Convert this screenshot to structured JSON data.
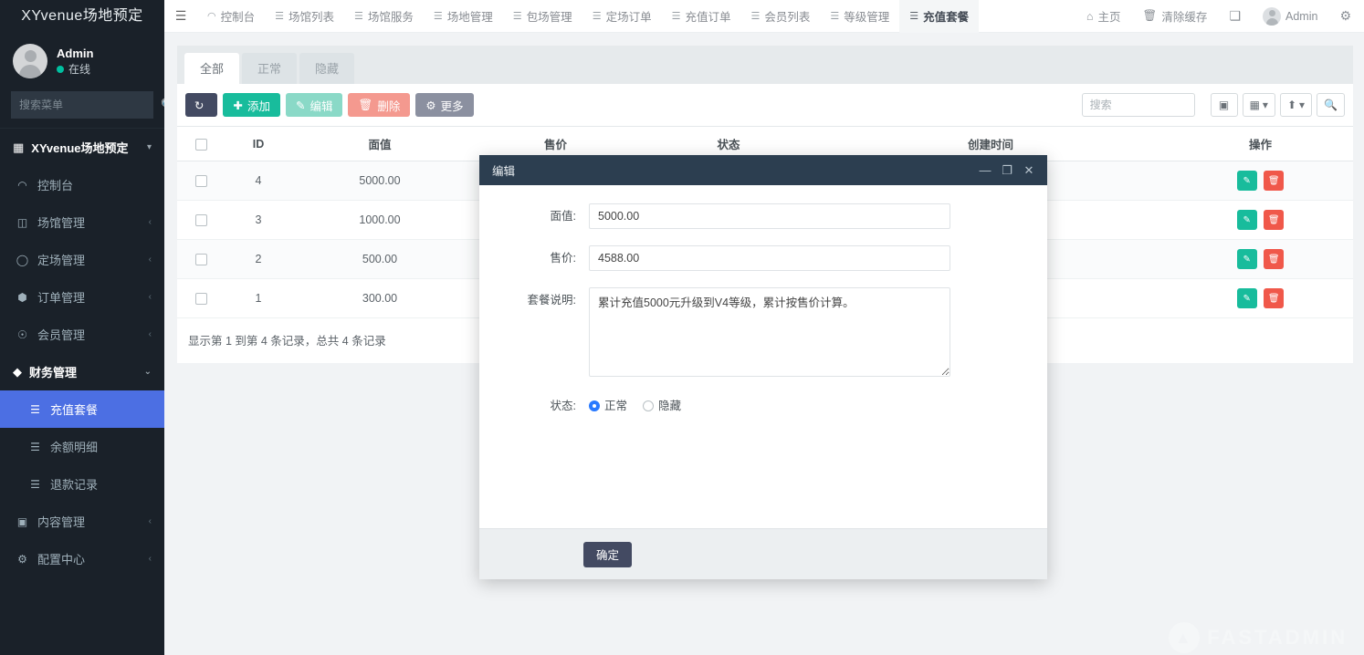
{
  "sidebar": {
    "brand": "XYvenue场地预定",
    "user": {
      "name": "Admin",
      "status": "在线"
    },
    "search_placeholder": "搜索菜单",
    "menu_head": "XYvenue场地预定",
    "items": [
      {
        "label": "控制台",
        "icon": "dashboard-icon",
        "caret": "",
        "active": false
      },
      {
        "label": "场馆管理",
        "icon": "columns-icon",
        "caret": "‹",
        "active": false
      },
      {
        "label": "定场管理",
        "icon": "clock-icon",
        "caret": "‹",
        "active": false
      },
      {
        "label": "订单管理",
        "icon": "cube-icon",
        "caret": "‹",
        "active": false
      },
      {
        "label": "会员管理",
        "icon": "user-icon",
        "caret": "‹",
        "active": false
      },
      {
        "label": "财务管理",
        "icon": "diamond-icon",
        "caret": "⌄",
        "active": false
      },
      {
        "label": "充值套餐",
        "icon": "list-icon",
        "caret": "",
        "active": true,
        "sub": true
      },
      {
        "label": "余额明细",
        "icon": "list-icon",
        "caret": "",
        "active": false,
        "sub": true
      },
      {
        "label": "退款记录",
        "icon": "list-icon",
        "caret": "",
        "active": false,
        "sub": true
      },
      {
        "label": "内容管理",
        "icon": "edit-square-icon",
        "caret": "‹",
        "active": false
      },
      {
        "label": "配置中心",
        "icon": "gear-icon",
        "caret": "‹",
        "active": false
      }
    ]
  },
  "topnav": {
    "toggle_icon": "hamburger-icon",
    "tabs": [
      {
        "label": "控制台",
        "icon": "dashboard-icon",
        "active": false
      },
      {
        "label": "场馆列表",
        "icon": "list-icon",
        "active": false
      },
      {
        "label": "场馆服务",
        "icon": "list-icon",
        "active": false
      },
      {
        "label": "场地管理",
        "icon": "list-icon",
        "active": false
      },
      {
        "label": "包场管理",
        "icon": "list-icon",
        "active": false
      },
      {
        "label": "定场订单",
        "icon": "list-icon",
        "active": false
      },
      {
        "label": "充值订单",
        "icon": "list-icon",
        "active": false
      },
      {
        "label": "会员列表",
        "icon": "list-icon",
        "active": false
      },
      {
        "label": "等级管理",
        "icon": "list-icon",
        "active": false
      },
      {
        "label": "充值套餐",
        "icon": "list-icon",
        "active": true
      }
    ],
    "right": [
      {
        "label": "主页",
        "icon": "home-icon"
      },
      {
        "label": "清除缓存",
        "icon": "trash-icon"
      },
      {
        "label": "",
        "icon": "fullscreen-icon"
      },
      {
        "label": "Admin",
        "icon": "avatar-icon"
      },
      {
        "label": "",
        "icon": "gears-icon"
      }
    ]
  },
  "panel": {
    "tabs": [
      {
        "label": "全部",
        "active": true
      },
      {
        "label": "正常",
        "active": false
      },
      {
        "label": "隐藏",
        "active": false
      }
    ],
    "toolbar": {
      "refresh_label": "",
      "add_label": "添加",
      "edit_label": "编辑",
      "delete_label": "删除",
      "more_label": "更多",
      "search_placeholder": "搜索",
      "icon_buttons": [
        "columns-toggle-icon",
        "grid-dropdown-icon",
        "export-dropdown-icon",
        "search-submit-icon"
      ]
    },
    "table": {
      "columns": [
        "",
        "ID",
        "面值",
        "售价",
        "状态",
        "创建时间",
        "操作"
      ],
      "rows": [
        {
          "id": "4",
          "facevalue": "5000.00",
          "price": "",
          "status": "",
          "createtime": "",
          "actions": [
            "edit-icon",
            "delete-icon"
          ]
        },
        {
          "id": "3",
          "facevalue": "1000.00",
          "price": "",
          "status": "",
          "createtime": "",
          "actions": [
            "edit-icon",
            "delete-icon"
          ]
        },
        {
          "id": "2",
          "facevalue": "500.00",
          "price": "",
          "status": "",
          "createtime": "",
          "actions": [
            "edit-icon",
            "delete-icon"
          ]
        },
        {
          "id": "1",
          "facevalue": "300.00",
          "price": "",
          "status": "",
          "createtime": "",
          "actions": [
            "edit-icon",
            "delete-icon"
          ]
        }
      ],
      "footer_text": "显示第 1 到第 4 条记录，总共 4 条记录"
    }
  },
  "modal": {
    "title": "编辑",
    "controls": {
      "minimize": "—",
      "maximize": "❐",
      "close": "✕"
    },
    "fields": {
      "facevalue_label": "面值:",
      "facevalue_value": "5000.00",
      "price_label": "售价:",
      "price_value": "4588.00",
      "desc_label": "套餐说明:",
      "desc_value": "累计充值5000元升级到V4等级，累计按售价计算。",
      "status_label": "状态:",
      "status_options": [
        {
          "label": "正常",
          "checked": true
        },
        {
          "label": "隐藏",
          "checked": false
        }
      ]
    },
    "confirm_label": "确定"
  },
  "watermark": {
    "text": "FASTADMIN"
  },
  "colors": {
    "sidebar_bg": "#1a2129",
    "sidebar_active": "#4c6fe3",
    "modal_header": "#2c3e50",
    "btn_add": "#18bc9c",
    "btn_delete": "#f0584a",
    "btn_dark": "#434a62",
    "radio_accent": "#2979ff",
    "online_dot": "#00c0a0"
  }
}
